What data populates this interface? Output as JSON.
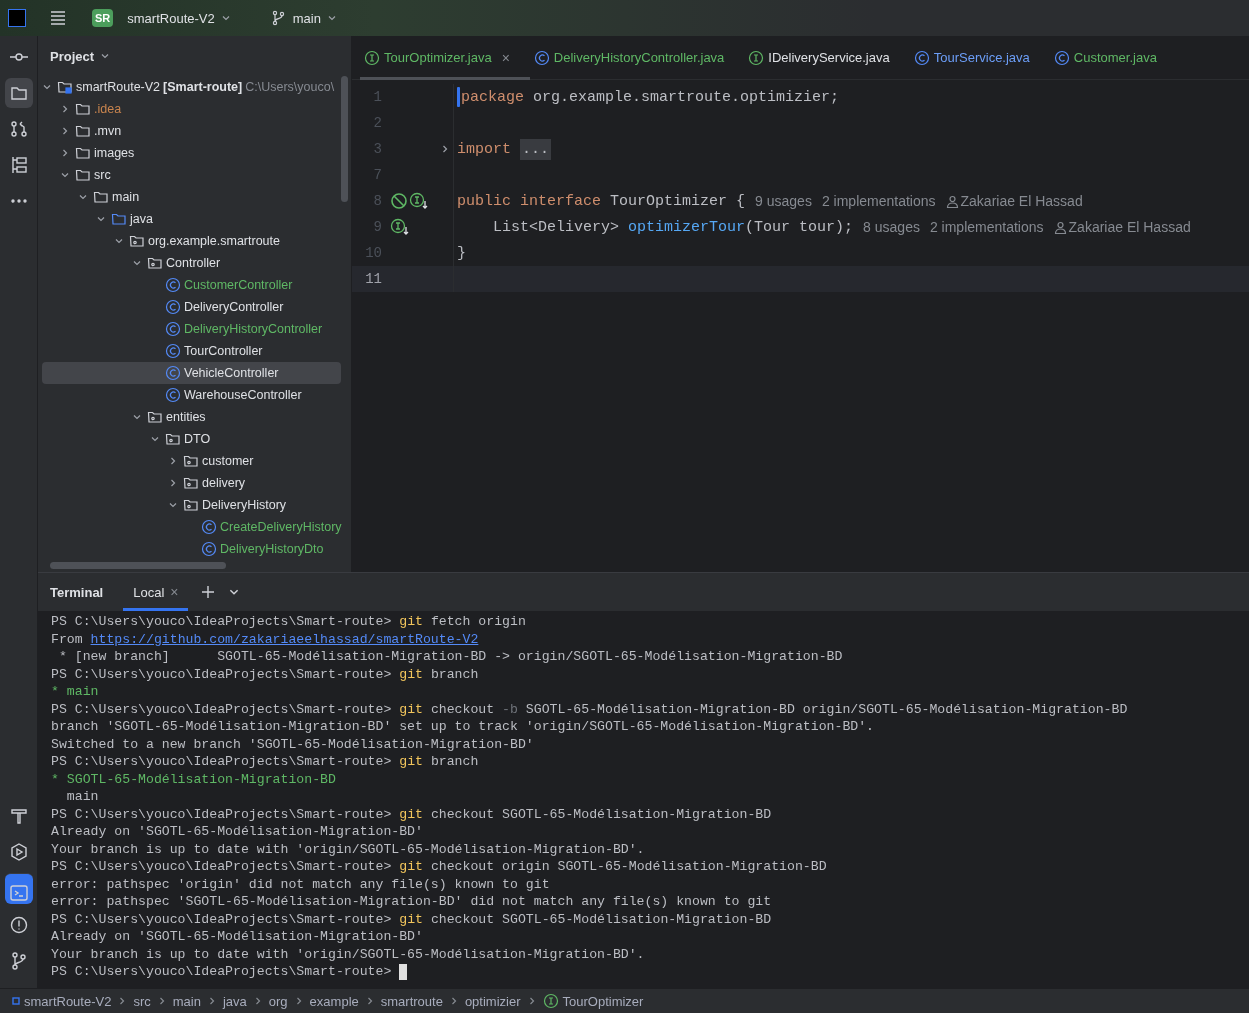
{
  "title_bar": {
    "project_badge": "SR",
    "project": "smartRoute-V2",
    "branch": "main"
  },
  "left_toolbar": {
    "top": [
      {
        "kind": "commit",
        "selected": false
      },
      {
        "kind": "project",
        "selected": true
      },
      {
        "kind": "pull-requests",
        "selected": false
      },
      {
        "kind": "structure",
        "selected": false
      },
      {
        "kind": "more",
        "selected": false
      }
    ],
    "bottom": [
      {
        "kind": "build",
        "selected": false
      },
      {
        "kind": "services",
        "selected": false
      },
      {
        "kind": "terminal",
        "selected": true
      },
      {
        "kind": "problems",
        "selected": false
      },
      {
        "kind": "git",
        "selected": false
      }
    ]
  },
  "project_panel": {
    "title": "Project",
    "tree": [
      {
        "label": "smartRoute-V2",
        "module": "[Smart-route]",
        "path": "C:\\Users\\youco\\",
        "kind": "module",
        "color": "#dfe1e5",
        "expanded": true,
        "selected": false,
        "children": [
          {
            "label": ".idea",
            "kind": "folder",
            "color": "#c8844e",
            "expanded": false,
            "selected": false
          },
          {
            "label": ".mvn",
            "kind": "folder",
            "color": "#dfe1e5",
            "expanded": false,
            "selected": false
          },
          {
            "label": "images",
            "kind": "folder",
            "color": "#dfe1e5",
            "expanded": false,
            "selected": false
          },
          {
            "label": "src",
            "kind": "folder",
            "color": "#dfe1e5",
            "expanded": true,
            "selected": false,
            "children": [
              {
                "label": "main",
                "kind": "folder",
                "color": "#dfe1e5",
                "expanded": true,
                "selected": false,
                "children": [
                  {
                    "label": "java",
                    "kind": "source",
                    "color": "#dfe1e5",
                    "expanded": true,
                    "selected": false,
                    "children": [
                      {
                        "label": "org.example.smartroute",
                        "kind": "package",
                        "color": "#dfe1e5",
                        "expanded": true,
                        "selected": false,
                        "children": [
                          {
                            "label": "Controller",
                            "kind": "package",
                            "color": "#dfe1e5",
                            "expanded": true,
                            "selected": false,
                            "children": [
                              {
                                "label": "CustomerController",
                                "kind": "class",
                                "color": "#5fb865",
                                "selected": false
                              },
                              {
                                "label": "DeliveryController",
                                "kind": "class",
                                "color": "#dfe1e5",
                                "selected": false
                              },
                              {
                                "label": "DeliveryHistoryController",
                                "kind": "class",
                                "color": "#5fb865",
                                "selected": false
                              },
                              {
                                "label": "TourController",
                                "kind": "class",
                                "color": "#dfe1e5",
                                "selected": false
                              },
                              {
                                "label": "VehicleController",
                                "kind": "class",
                                "color": "#dfe1e5",
                                "selected": true
                              },
                              {
                                "label": "WarehouseController",
                                "kind": "class",
                                "color": "#dfe1e5",
                                "selected": false
                              }
                            ]
                          },
                          {
                            "label": "entities",
                            "kind": "package",
                            "color": "#dfe1e5",
                            "expanded": true,
                            "selected": false,
                            "children": [
                              {
                                "label": "DTO",
                                "kind": "package",
                                "color": "#dfe1e5",
                                "expanded": true,
                                "selected": false,
                                "children": [
                                  {
                                    "label": "customer",
                                    "kind": "package",
                                    "color": "#dfe1e5",
                                    "expanded": false,
                                    "selected": false
                                  },
                                  {
                                    "label": "delivery",
                                    "kind": "package",
                                    "color": "#dfe1e5",
                                    "expanded": false,
                                    "selected": false
                                  },
                                  {
                                    "label": "DeliveryHistory",
                                    "kind": "package",
                                    "color": "#dfe1e5",
                                    "expanded": true,
                                    "selected": false,
                                    "children": [
                                      {
                                        "label": "CreateDeliveryHistory",
                                        "kind": "class",
                                        "color": "#5fb865",
                                        "selected": false
                                      },
                                      {
                                        "label": "DeliveryHistoryDto",
                                        "kind": "class",
                                        "color": "#5fb865",
                                        "selected": false
                                      }
                                    ]
                                  }
                                ]
                              }
                            ]
                          }
                        ]
                      }
                    ]
                  }
                ]
              }
            ]
          }
        ]
      }
    ]
  },
  "editor": {
    "tabs": [
      {
        "label": "TourOptimizer.java",
        "kind": "interface",
        "color": "#5fb865",
        "selected": true,
        "closable": true
      },
      {
        "label": "DeliveryHistoryController.java",
        "kind": "class",
        "color": "#5fb865",
        "selected": false,
        "closable": false
      },
      {
        "label": "IDeliveryService.java",
        "kind": "interface",
        "color": "#dfe1e5",
        "selected": false,
        "closable": false
      },
      {
        "label": "TourService.java",
        "kind": "class",
        "color": "#6c9ef8",
        "selected": false,
        "closable": false
      },
      {
        "label": "Customer.java",
        "kind": "class",
        "color": "#5fb865",
        "selected": false,
        "closable": false
      }
    ],
    "close_glyph": "×",
    "lines": [
      {
        "number": "1",
        "caret": true,
        "current": false,
        "tokens": [
          {
            "text": "package",
            "kind": "keyword"
          },
          {
            "text": " org.example.smartroute.optimizier;",
            "kind": "plain"
          }
        ]
      },
      {
        "number": "2",
        "caret": false,
        "current": false
      },
      {
        "number": "3",
        "caret": false,
        "current": false,
        "foldable": true,
        "tokens": [
          {
            "text": "import",
            "kind": "keyword"
          },
          {
            "text": "...",
            "kind": "folded"
          }
        ]
      },
      {
        "number": "7",
        "caret": false,
        "current": false
      },
      {
        "number": "8",
        "caret": false,
        "current": false,
        "gutter": [
          {
            "kind": "blocked"
          },
          {
            "kind": "implemented"
          }
        ],
        "tokens": [
          {
            "text": "public interface",
            "kind": "keyword"
          },
          {
            "text": " TourOptimizer {",
            "kind": "plain"
          }
        ],
        "hints": [
          {
            "text": "9 usages",
            "kind": "usage"
          },
          {
            "text": "2 implementations",
            "kind": "usage"
          },
          {
            "text": "Zakariae El Hassad",
            "kind": "author"
          }
        ]
      },
      {
        "number": "9",
        "caret": false,
        "current": false,
        "gutter": [
          {
            "kind": "implemented"
          }
        ],
        "tokens": [
          {
            "text": "    List<Delivery> ",
            "kind": "plain"
          },
          {
            "text": "optimizerTour",
            "kind": "method"
          },
          {
            "text": "(Tour tour);",
            "kind": "plain"
          }
        ],
        "hints": [
          {
            "text": "8 usages",
            "kind": "usage"
          },
          {
            "text": "2 implementations",
            "kind": "usage"
          },
          {
            "text": "Zakariae El Hassad",
            "kind": "author"
          }
        ]
      },
      {
        "number": "10",
        "caret": false,
        "current": false,
        "tokens": [
          {
            "text": "}",
            "kind": "plain"
          }
        ]
      },
      {
        "number": "11",
        "caret": false,
        "current": true
      }
    ]
  },
  "terminal": {
    "title": "Terminal",
    "tabs": [
      {
        "label": "Local",
        "selected": true
      }
    ],
    "close_glyph": "×",
    "cursor_visible": true,
    "lines": [
      [
        {
          "text": "PS C:\\Users\\youco\\IdeaProjects\\Smart-route> ",
          "kind": "plain"
        },
        {
          "text": "git",
          "kind": "command"
        },
        {
          "text": " fetch origin",
          "kind": "plain"
        }
      ],
      [
        {
          "text": "From ",
          "kind": "plain"
        },
        {
          "text": "https://github.com/zakariaeelhassad/smartRoute-V2",
          "kind": "link"
        }
      ],
      [
        {
          "text": " * [new branch]      SGOTL-65-Modélisation-Migration-BD -> origin/SGOTL-65-Modélisation-Migration-BD",
          "kind": "plain"
        }
      ],
      [
        {
          "text": "PS C:\\Users\\youco\\IdeaProjects\\Smart-route> ",
          "kind": "plain"
        },
        {
          "text": "git",
          "kind": "command"
        },
        {
          "text": " branch",
          "kind": "plain"
        }
      ],
      [
        {
          "text": "* main",
          "kind": "branch"
        }
      ],
      [
        {
          "text": "PS C:\\Users\\youco\\IdeaProjects\\Smart-route> ",
          "kind": "plain"
        },
        {
          "text": "git",
          "kind": "command"
        },
        {
          "text": " checkout ",
          "kind": "plain"
        },
        {
          "text": "-b",
          "kind": "flag"
        },
        {
          "text": " SGOTL-65-Modélisation-Migration-BD origin/SGOTL-65-Modélisation-Migration-BD",
          "kind": "plain"
        }
      ],
      [
        {
          "text": "branch 'SGOTL-65-Modélisation-Migration-BD' set up to track 'origin/SGOTL-65-Modélisation-Migration-BD'.",
          "kind": "plain"
        }
      ],
      [
        {
          "text": "Switched to a new branch 'SGOTL-65-Modélisation-Migration-BD'",
          "kind": "plain"
        }
      ],
      [
        {
          "text": "PS C:\\Users\\youco\\IdeaProjects\\Smart-route> ",
          "kind": "plain"
        },
        {
          "text": "git",
          "kind": "command"
        },
        {
          "text": " branch",
          "kind": "plain"
        }
      ],
      [
        {
          "text": "* SGOTL-65-Modélisation-Migration-BD",
          "kind": "branch"
        }
      ],
      [
        {
          "text": "  main",
          "kind": "plain"
        }
      ],
      [
        {
          "text": "PS C:\\Users\\youco\\IdeaProjects\\Smart-route> ",
          "kind": "plain"
        },
        {
          "text": "git",
          "kind": "command"
        },
        {
          "text": " checkout SGOTL-65-Modélisation-Migration-BD",
          "kind": "plain"
        }
      ],
      [
        {
          "text": "Already on 'SGOTL-65-Modélisation-Migration-BD'",
          "kind": "plain"
        }
      ],
      [
        {
          "text": "Your branch is up to date with 'origin/SGOTL-65-Modélisation-Migration-BD'.",
          "kind": "plain"
        }
      ],
      [
        {
          "text": "PS C:\\Users\\youco\\IdeaProjects\\Smart-route> ",
          "kind": "plain"
        },
        {
          "text": "git",
          "kind": "command"
        },
        {
          "text": " checkout origin SGOTL-65-Modélisation-Migration-BD",
          "kind": "plain"
        }
      ],
      [
        {
          "text": "error: pathspec 'origin' did not match any file(s) known to git",
          "kind": "plain"
        }
      ],
      [
        {
          "text": "error: pathspec 'SGOTL-65-Modélisation-Migration-BD' did not match any file(s) known to git",
          "kind": "plain"
        }
      ],
      [
        {
          "text": "PS C:\\Users\\youco\\IdeaProjects\\Smart-route> ",
          "kind": "plain"
        },
        {
          "text": "git",
          "kind": "command"
        },
        {
          "text": " checkout SGOTL-65-Modélisation-Migration-BD",
          "kind": "plain"
        }
      ],
      [
        {
          "text": "Already on 'SGOTL-65-Modélisation-Migration-BD'",
          "kind": "plain"
        }
      ],
      [
        {
          "text": "Your branch is up to date with 'origin/SGOTL-65-Modélisation-Migration-BD'.",
          "kind": "plain"
        }
      ],
      [
        {
          "text": "PS C:\\Users\\youco\\IdeaProjects\\Smart-route> ",
          "kind": "plain"
        }
      ]
    ]
  },
  "status_bar": {
    "breadcrumbs": [
      {
        "label": "smartRoute-V2",
        "kind": "module"
      },
      {
        "label": "src",
        "kind": "plain"
      },
      {
        "label": "main",
        "kind": "plain"
      },
      {
        "label": "java",
        "kind": "plain"
      },
      {
        "label": "org",
        "kind": "plain"
      },
      {
        "label": "example",
        "kind": "plain"
      },
      {
        "label": "smartroute",
        "kind": "plain"
      },
      {
        "label": "optimizier",
        "kind": "plain"
      },
      {
        "label": "TourOptimizer",
        "kind": "interface"
      }
    ]
  }
}
